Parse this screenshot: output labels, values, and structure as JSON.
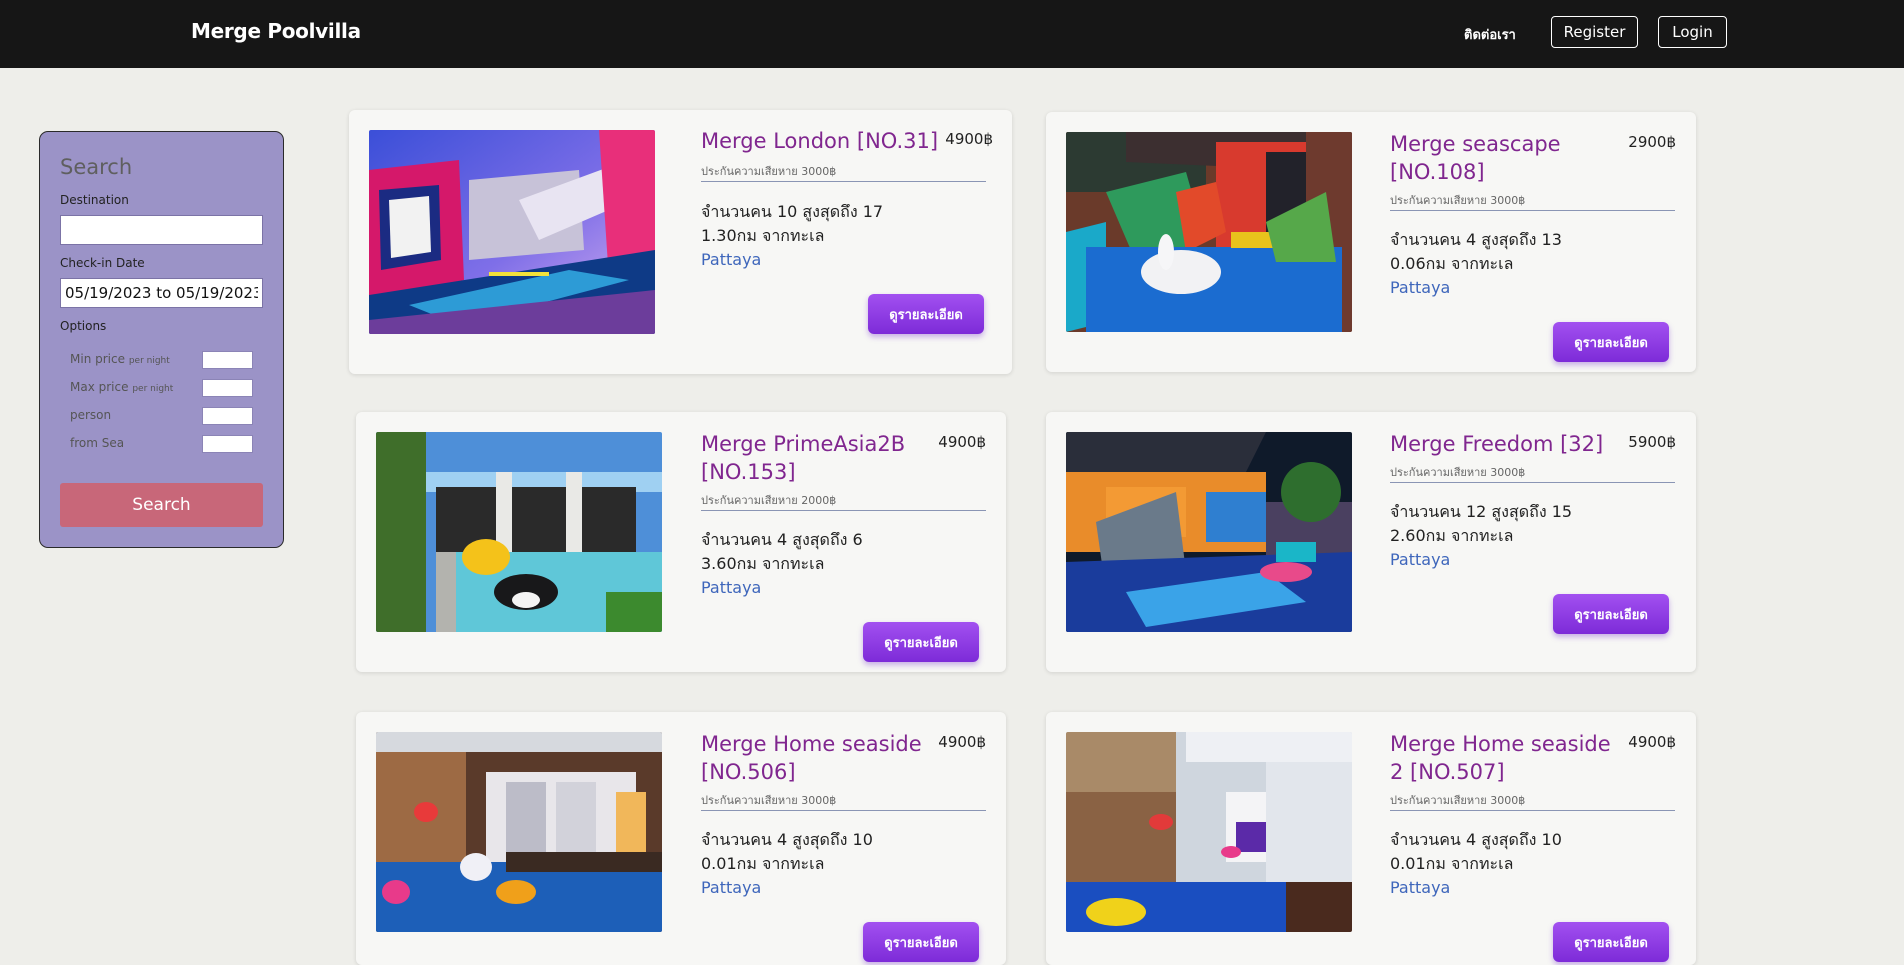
{
  "header": {
    "brand": "Merge Poolvilla",
    "contact": "ติดต่อเรา",
    "register": "Register",
    "login": "Login"
  },
  "search": {
    "title": "Search",
    "destination_label": "Destination",
    "destination_value": "",
    "checkin_label": "Check-in Date",
    "checkin_value": "05/19/2023 to 05/19/2023",
    "options_label": "Options",
    "min_price_label": "Min price",
    "max_price_label": "Max price",
    "per_night": "per night",
    "person_label": "person",
    "from_sea_label": "from Sea",
    "search_button": "Search"
  },
  "listings": [
    {
      "name": "Merge London [NO.31]",
      "price": "4900฿",
      "deposit": "ประกันความเสียหาย 3000฿",
      "capacity": "จำนวนคน 10 สูงสุดถึง 17",
      "distance": "1.30กม จากทะเล",
      "location": "Pattaya",
      "button": "ดูรายละเอียด"
    },
    {
      "name": "Merge seascape [NO.108]",
      "price": "2900฿",
      "deposit": "ประกันความเสียหาย 3000฿",
      "capacity": "จำนวนคน 4 สูงสุดถึง 13",
      "distance": "0.06กม จากทะเล",
      "location": "Pattaya",
      "button": "ดูรายละเอียด"
    },
    {
      "name": "Merge PrimeAsia2B [NO.153]",
      "price": "4900฿",
      "deposit": "ประกันความเสียหาย 2000฿",
      "capacity": "จำนวนคน 4 สูงสุดถึง 6",
      "distance": "3.60กม จากทะเล",
      "location": "Pattaya",
      "button": "ดูรายละเอียด"
    },
    {
      "name": "Merge Freedom [32]",
      "price": "5900฿",
      "deposit": "ประกันความเสียหาย 3000฿",
      "capacity": "จำนวนคน 12 สูงสุดถึง 15",
      "distance": "2.60กม จากทะเล",
      "location": "Pattaya",
      "button": "ดูรายละเอียด"
    },
    {
      "name": "Merge Home seaside [NO.506]",
      "price": "4900฿",
      "deposit": "ประกันความเสียหาย 3000฿",
      "capacity": "จำนวนคน 4 สูงสุดถึง 10",
      "distance": "0.01กม จากทะเล",
      "location": "Pattaya",
      "button": "ดูรายละเอียด"
    },
    {
      "name": "Merge Home seaside 2 [NO.507]",
      "price": "4900฿",
      "deposit": "ประกันความเสียหาย 3000฿",
      "capacity": "จำนวนคน 4 สูงสุดถึง 10",
      "distance": "0.01กม จากทะเล",
      "location": "Pattaya",
      "button": "ดูรายละเอียด"
    }
  ]
}
